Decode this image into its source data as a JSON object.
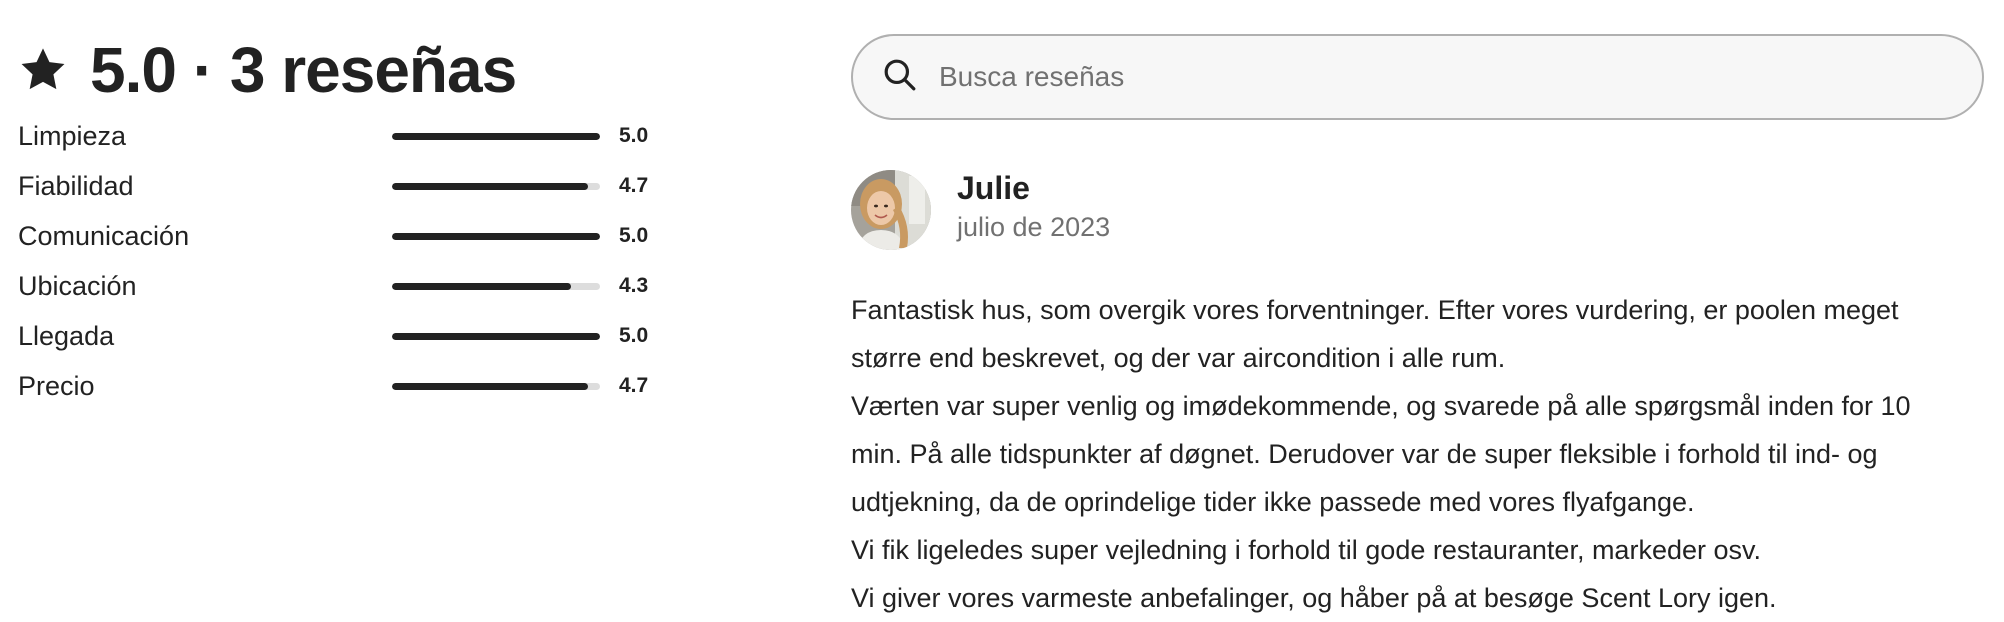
{
  "summary": {
    "text": "5.0 · 3 reseñas",
    "star_icon": "star-icon"
  },
  "ratings": [
    {
      "label": "Limpieza",
      "value": "5.0",
      "fraction": 1.0
    },
    {
      "label": "Fiabilidad",
      "value": "4.7",
      "fraction": 0.94
    },
    {
      "label": "Comunicación",
      "value": "5.0",
      "fraction": 1.0
    },
    {
      "label": "Ubicación",
      "value": "4.3",
      "fraction": 0.86
    },
    {
      "label": "Llegada",
      "value": "5.0",
      "fraction": 1.0
    },
    {
      "label": "Precio",
      "value": "4.7",
      "fraction": 0.94
    }
  ],
  "search": {
    "placeholder": "Busca reseñas",
    "icon": "search-icon"
  },
  "review": {
    "name": "Julie",
    "date": "julio de 2023",
    "lines": [
      "Fantastisk hus, som overgik vores forventninger. Efter vores vurdering, er poolen meget",
      "større end beskrevet, og der var aircondition i alle rum.",
      "Værten var super venlig og imødekommende, og svarede på alle spørgsmål inden for 10",
      "min. På alle tidspunkter af døgnet. Derudover var de super fleksible i forhold til ind- og",
      "udtjekning, da de oprindelige tider ikke passede med vores flyafgange.",
      "Vi fik ligeledes super vejledning i forhold til gode restauranter, markeder osv.",
      "Vi giver vores varmeste anbefalinger, og håber på at besøge Scent Lory igen."
    ]
  },
  "colors": {
    "text": "#222222",
    "muted": "#717171",
    "bar_fill": "#222222",
    "bar_track": "#dddddd",
    "search_bg": "#f7f7f7",
    "search_border": "#b0b0b0"
  }
}
